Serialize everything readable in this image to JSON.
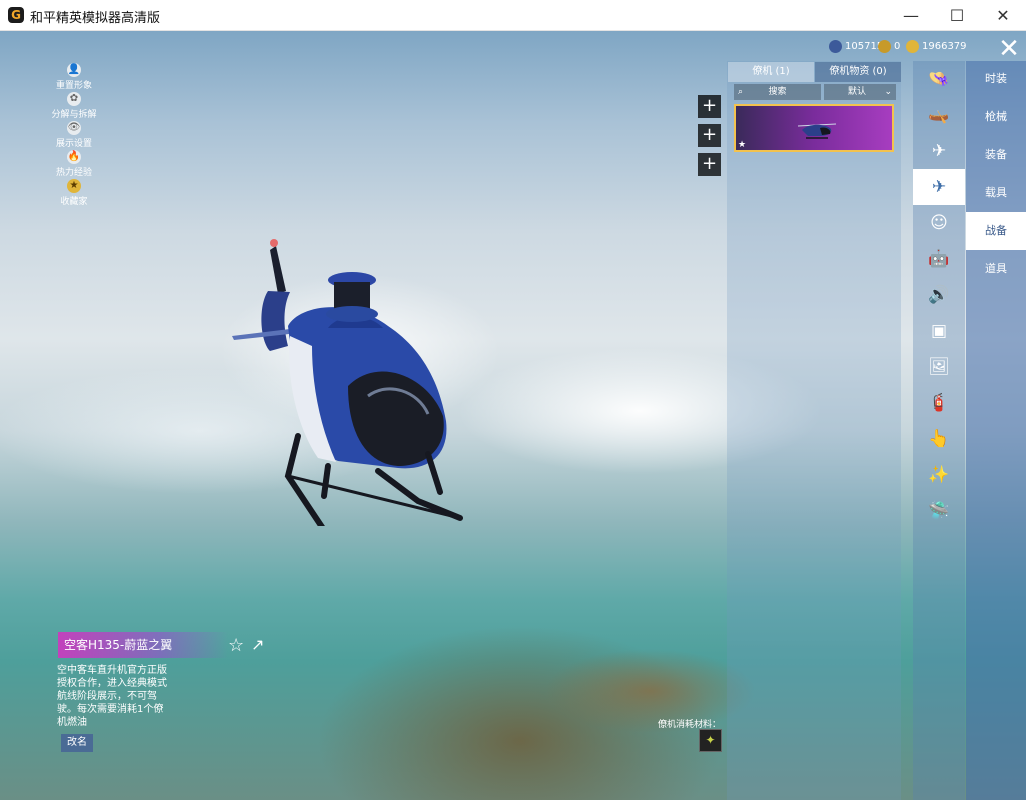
{
  "window": {
    "title": "和平精英模拟器高清版",
    "logo": "G",
    "minimize_icon": "—",
    "maximize_icon": "☐",
    "close_icon": "✕"
  },
  "currency": [
    {
      "icon": "coin-icon",
      "value": "105715",
      "color": "#3c5a9a"
    },
    {
      "icon": "medal-icon",
      "value": "0",
      "color": "#c79a2a"
    },
    {
      "icon": "gold-icon",
      "value": "1966379",
      "color": "#e0b53a"
    }
  ],
  "panel_close_icon": "✕",
  "left_tools": [
    {
      "label": "重置形象",
      "icon": "👤"
    },
    {
      "label": "分解与拆解",
      "icon": "✿"
    },
    {
      "label": "展示设置",
      "icon": "👁"
    },
    {
      "label": "热力经验",
      "icon": "🔥"
    },
    {
      "label": "收藏家",
      "icon": "★"
    }
  ],
  "plus_buttons": [
    "+",
    "+",
    "+"
  ],
  "panel": {
    "tabs": [
      {
        "label": "僚机 (1)",
        "active": true
      },
      {
        "label": "僚机物资 (0)",
        "active": false
      }
    ],
    "search_placeholder": "搜索",
    "sort_label": "默认"
  },
  "categories": [
    {
      "name": "category-hat",
      "icon": "👒"
    },
    {
      "name": "category-boat",
      "icon": "🛶"
    },
    {
      "name": "category-glider",
      "icon": "✈"
    },
    {
      "name": "category-plane",
      "icon": "✈",
      "active": true
    },
    {
      "name": "category-emote",
      "icon": "☺"
    },
    {
      "name": "category-robot",
      "icon": "🤖"
    },
    {
      "name": "category-sound",
      "icon": "🔊"
    },
    {
      "name": "category-card",
      "icon": "▣"
    },
    {
      "name": "category-photo",
      "icon": "🖼"
    },
    {
      "name": "category-spray",
      "icon": "🧯"
    },
    {
      "name": "category-gesture",
      "icon": "👆"
    },
    {
      "name": "category-sparkle",
      "icon": "✨"
    },
    {
      "name": "category-ufo",
      "icon": "🛸"
    }
  ],
  "tabs": [
    {
      "label": "时装",
      "active": false
    },
    {
      "label": "枪械",
      "active": false
    },
    {
      "label": "装备",
      "active": false
    },
    {
      "label": "载具",
      "active": false
    },
    {
      "label": "战备",
      "active": true
    },
    {
      "label": "道具",
      "active": false
    }
  ],
  "item": {
    "title": "空客H135-蔚蓝之翼",
    "description": "空中客车直升机官方正版授权合作，进入经典模式航线阶段展示，不可驾驶。每次需要消耗1个僚机燃油",
    "rename_label": "改名",
    "favorite_icon": "☆",
    "share_icon": "↗"
  },
  "materials": {
    "label": "僚机消耗材料：",
    "item_icon": "✦"
  }
}
